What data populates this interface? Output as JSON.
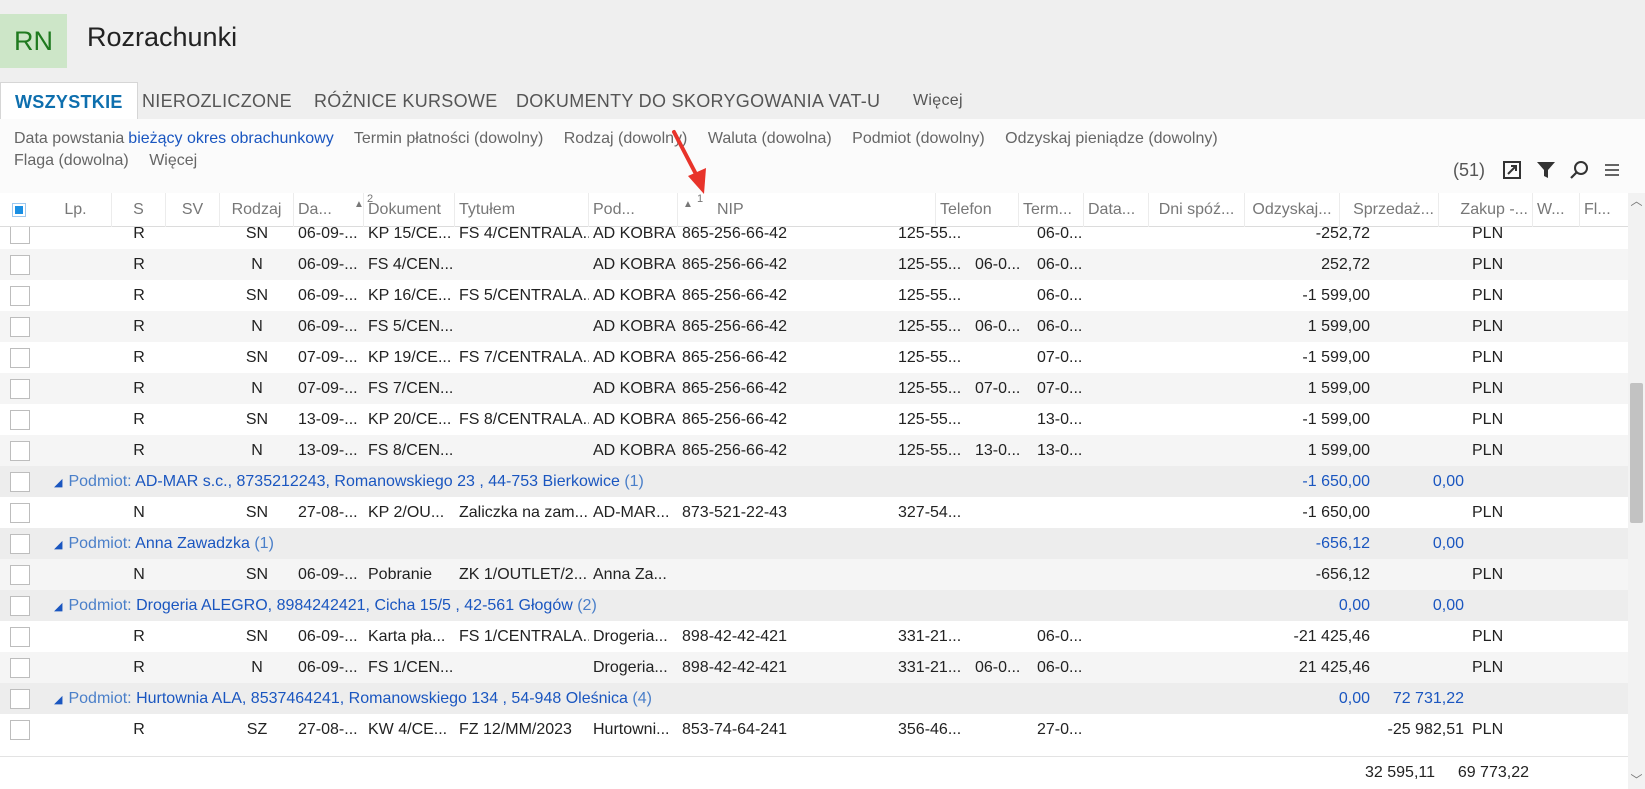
{
  "app": {
    "badge": "RN",
    "title": "Rozrachunki"
  },
  "tabs": [
    {
      "label": "WSZYSTKIE"
    },
    {
      "label": "NIEROZLICZONE"
    },
    {
      "label": "RÓŻNICE KURSOWE"
    },
    {
      "label": "DOKUMENTY DO SKORYGOWANIA VAT-U"
    },
    {
      "label": "Więcej"
    }
  ],
  "filters": {
    "date_label": "Data powstania",
    "date_value": "bieżący okres obrachunkowy",
    "due": "Termin płatności (dowolny)",
    "type": "Rodzaj (dowolny)",
    "currency": "Waluta (dowolna)",
    "subject": "Podmiot (dowolny)",
    "recover": "Odzyskaj pieniądze (dowolny)",
    "flag": "Flaga (dowolna)",
    "more": "Więcej"
  },
  "toolbar": {
    "count": "(51)",
    "icons": [
      "export-icon",
      "filter-icon",
      "search-icon",
      "menu-icon"
    ]
  },
  "columns": {
    "lp": "Lp.",
    "s": "S",
    "sv": "SV",
    "rodzaj": "Rodzaj",
    "data": "Da...",
    "data_sort": "2",
    "dokument": "Dokument",
    "tytulem": "Tytułem",
    "podmiot": "Pod...",
    "podmiot_sort": "1",
    "nip": "NIP",
    "telefon": "Telefon",
    "termin": "Term...",
    "data2": "Data...",
    "dni": "Dni spóź...",
    "odzyskaj": "Odzyskaj...",
    "sprzedaz": "Sprzedaż...",
    "zakup": "Zakup -...",
    "waluta": "W...",
    "flaga": "Fl..."
  },
  "rows": [
    {
      "kind": "data",
      "s": "R",
      "rodzaj": "SN",
      "data": "06-09-...",
      "dokument": "KP 15/CE...",
      "tytulem": "FS 4/CENTRALA...",
      "podmiot": "AD KOBRA",
      "nip": "865-256-66-42",
      "telefon": "125-55...",
      "termin": "",
      "data2": "06-0...",
      "sprzedaz": "-252,72",
      "zakup": "",
      "waluta": "PLN"
    },
    {
      "kind": "data",
      "s": "R",
      "rodzaj": "N",
      "data": "06-09-...",
      "dokument": "FS 4/CEN...",
      "tytulem": "",
      "podmiot": "AD KOBRA",
      "nip": "865-256-66-42",
      "telefon": "125-55...",
      "termin": "06-0...",
      "data2": "06-0...",
      "sprzedaz": "252,72",
      "zakup": "",
      "waluta": "PLN"
    },
    {
      "kind": "data",
      "s": "R",
      "rodzaj": "SN",
      "data": "06-09-...",
      "dokument": "KP 16/CE...",
      "tytulem": "FS 5/CENTRALA...",
      "podmiot": "AD KOBRA",
      "nip": "865-256-66-42",
      "telefon": "125-55...",
      "termin": "",
      "data2": "06-0...",
      "sprzedaz": "-1 599,00",
      "zakup": "",
      "waluta": "PLN"
    },
    {
      "kind": "data",
      "s": "R",
      "rodzaj": "N",
      "data": "06-09-...",
      "dokument": "FS 5/CEN...",
      "tytulem": "",
      "podmiot": "AD KOBRA",
      "nip": "865-256-66-42",
      "telefon": "125-55...",
      "termin": "06-0...",
      "data2": "06-0...",
      "sprzedaz": "1 599,00",
      "zakup": "",
      "waluta": "PLN"
    },
    {
      "kind": "data",
      "s": "R",
      "rodzaj": "SN",
      "data": "07-09-...",
      "dokument": "KP 19/CE...",
      "tytulem": "FS 7/CENTRALA...",
      "podmiot": "AD KOBRA",
      "nip": "865-256-66-42",
      "telefon": "125-55...",
      "termin": "",
      "data2": "07-0...",
      "sprzedaz": "-1 599,00",
      "zakup": "",
      "waluta": "PLN"
    },
    {
      "kind": "data",
      "s": "R",
      "rodzaj": "N",
      "data": "07-09-...",
      "dokument": "FS 7/CEN...",
      "tytulem": "",
      "podmiot": "AD KOBRA",
      "nip": "865-256-66-42",
      "telefon": "125-55...",
      "termin": "07-0...",
      "data2": "07-0...",
      "sprzedaz": "1 599,00",
      "zakup": "",
      "waluta": "PLN"
    },
    {
      "kind": "data",
      "s": "R",
      "rodzaj": "SN",
      "data": "13-09-...",
      "dokument": "KP 20/CE...",
      "tytulem": "FS 8/CENTRALA...",
      "podmiot": "AD KOBRA",
      "nip": "865-256-66-42",
      "telefon": "125-55...",
      "termin": "",
      "data2": "13-0...",
      "sprzedaz": "-1 599,00",
      "zakup": "",
      "waluta": "PLN"
    },
    {
      "kind": "data",
      "s": "R",
      "rodzaj": "N",
      "data": "13-09-...",
      "dokument": "FS 8/CEN...",
      "tytulem": "",
      "podmiot": "AD KOBRA",
      "nip": "865-256-66-42",
      "telefon": "125-55...",
      "termin": "13-0...",
      "data2": "13-0...",
      "sprzedaz": "1 599,00",
      "zakup": "",
      "waluta": "PLN"
    },
    {
      "kind": "group",
      "prefix": "Podmiot: ",
      "label": "AD-MAR s.c., 8735212243, Romanowskiego 23 , 44-753 Bierkowice",
      "count": " (1)",
      "sprzedaz": "-1 650,00",
      "zakup": "0,00"
    },
    {
      "kind": "data",
      "s": "N",
      "rodzaj": "SN",
      "data": "27-08-...",
      "dokument": "KP 2/OU...",
      "tytulem": "Zaliczka na zam...",
      "podmiot": "AD-MAR...",
      "nip": "873-521-22-43",
      "telefon": "327-54...",
      "termin": "",
      "data2": "",
      "sprzedaz": "-1 650,00",
      "zakup": "",
      "waluta": "PLN"
    },
    {
      "kind": "group",
      "prefix": "Podmiot: ",
      "label": "Anna Zawadzka",
      "count": " (1)",
      "sprzedaz": "-656,12",
      "zakup": "0,00"
    },
    {
      "kind": "data",
      "s": "N",
      "rodzaj": "SN",
      "data": "06-09-...",
      "dokument": "Pobranie",
      "tytulem": "ZK 1/OUTLET/2...",
      "podmiot": "Anna Za...",
      "nip": "",
      "telefon": "",
      "termin": "",
      "data2": "",
      "sprzedaz": "-656,12",
      "zakup": "",
      "waluta": "PLN"
    },
    {
      "kind": "group",
      "prefix": "Podmiot: ",
      "label": "Drogeria ALEGRO, 8984242421, Cicha  15/5 , 42-561 Głogów",
      "count": " (2)",
      "sprzedaz": "0,00",
      "zakup": "0,00"
    },
    {
      "kind": "data",
      "s": "R",
      "rodzaj": "SN",
      "data": "06-09-...",
      "dokument": "Karta pła...",
      "tytulem": "FS 1/CENTRALA...",
      "podmiot": "Drogeria...",
      "nip": "898-42-42-421",
      "telefon": "331-21...",
      "termin": "",
      "data2": "06-0...",
      "sprzedaz": "-21 425,46",
      "zakup": "",
      "waluta": "PLN"
    },
    {
      "kind": "data",
      "s": "R",
      "rodzaj": "N",
      "data": "06-09-...",
      "dokument": "FS 1/CEN...",
      "tytulem": "",
      "podmiot": "Drogeria...",
      "nip": "898-42-42-421",
      "telefon": "331-21...",
      "termin": "06-0...",
      "data2": "06-0...",
      "sprzedaz": "21 425,46",
      "zakup": "",
      "waluta": "PLN"
    },
    {
      "kind": "group",
      "prefix": "Podmiot: ",
      "label": "Hurtownia ALA, 8537464241, Romanowskiego 134 , 54-948 Oleśnica",
      "count": " (4)",
      "sprzedaz": "0,00",
      "zakup": "72 731,22"
    },
    {
      "kind": "data",
      "s": "R",
      "rodzaj": "SZ",
      "data": "27-08-...",
      "dokument": "KW 4/CE...",
      "tytulem": "FZ 12/MM/2023",
      "podmiot": "Hurtowni...",
      "nip": "853-74-64-241",
      "telefon": "356-46...",
      "termin": "",
      "data2": "27-0...",
      "sprzedaz": "",
      "zakup": "-25 982,51",
      "waluta": "PLN"
    }
  ],
  "totals": {
    "sprzedaz": "32 595,11",
    "zakup": "69 773,22"
  },
  "colors": {
    "accent": "#0e6fae",
    "link": "#1a56c0",
    "badge_bg": "#cde6c8",
    "badge_fg": "#1f7a1f",
    "annotation": "#e8332a"
  }
}
